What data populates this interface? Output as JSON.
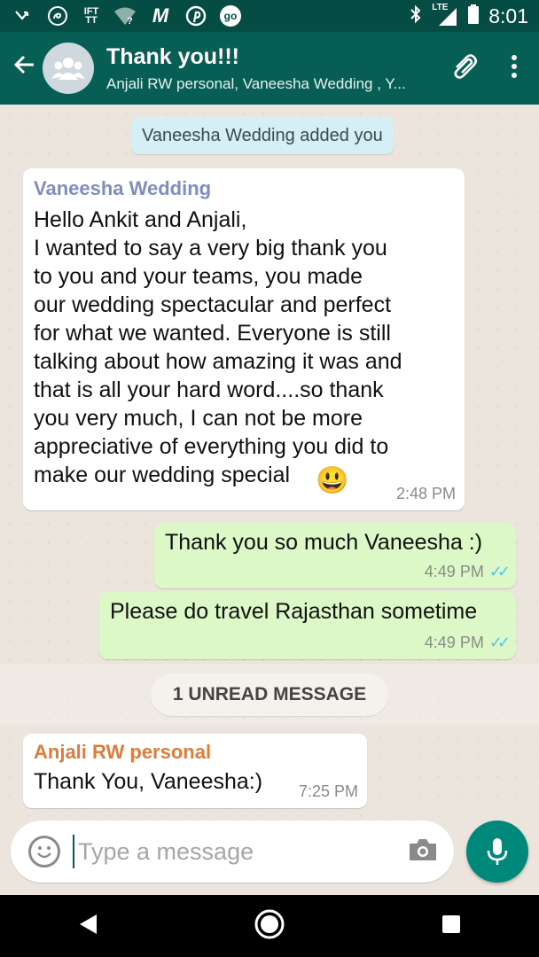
{
  "status_bar": {
    "time": "8:01",
    "network": "LTE",
    "icons": [
      "missed-call-icon",
      "swirl-icon",
      "ifttt-icon",
      "wifi-question-icon",
      "gmail-icon",
      "pinterest-icon",
      "go-icon",
      "bluetooth-icon",
      "signal-icon",
      "battery-icon"
    ],
    "ifttt_label": "IFT TT",
    "go_label": "go"
  },
  "header": {
    "title": "Thank you!!!",
    "subtitle": "Anjali RW personal, Vaneesha Wedding , Y..."
  },
  "messages": {
    "system_notice": "Vaneesha Wedding added you",
    "m1": {
      "sender": "Vaneesha Wedding",
      "text": "Hello Ankit and Anjali,\nI wanted to say a very big thank you\nto you and your teams, you made\nour wedding spectacular and perfect\nfor what we wanted. Everyone is still\ntalking about how amazing it was and\nthat is all your hard word....so thank\nyou very much, I can not be more\nappreciative of everything you did to\nmake our wedding special",
      "emoji": "😃",
      "time": "2:48 PM"
    },
    "m2": {
      "text": "Thank you so much Vaneesha :)",
      "time": "4:49 PM"
    },
    "m3": {
      "text": "Please do travel Rajasthan sometime",
      "time": "4:49 PM"
    },
    "unread_label": "1 UNREAD MESSAGE",
    "m4": {
      "sender": "Anjali RW personal",
      "text": "Thank You, Vaneesha:)",
      "time": "7:25 PM"
    }
  },
  "composer": {
    "placeholder": "Type a message"
  },
  "colors": {
    "header": "#075e54",
    "status_bar": "#054d44",
    "outgoing_bubble": "#dcf8c6",
    "incoming_bubble": "#ffffff",
    "sender_vaneesha": "#7e8ec4",
    "sender_anjali": "#e07b39",
    "read_ticks": "#4fc3f7",
    "fab": "#00897b"
  }
}
